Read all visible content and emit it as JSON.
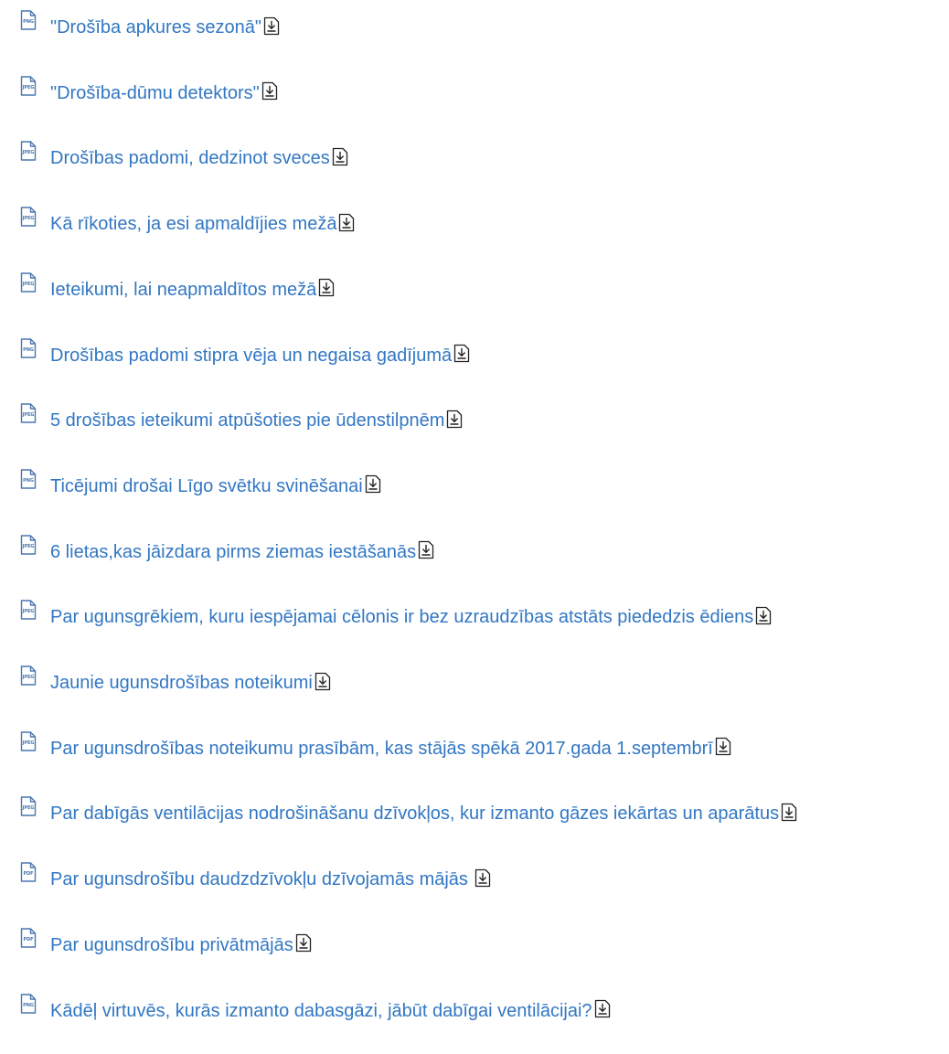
{
  "files": [
    {
      "ext": "PNG",
      "name": "\"Drošība apkures sezonā\""
    },
    {
      "ext": "JPEG",
      "name": "\"Drošība-dūmu detektors\""
    },
    {
      "ext": "JPEG",
      "name": "Drošības padomi, dedzinot sveces"
    },
    {
      "ext": "JPEG",
      "name": "Kā rīkoties, ja esi apmaldījies mežā"
    },
    {
      "ext": "JPEG",
      "name": "Ieteikumi, lai neapmaldītos mežā"
    },
    {
      "ext": "PNG",
      "name": "Drošības padomi stipra vēja un negaisa gadījumā"
    },
    {
      "ext": "JPEG",
      "name": "5 drošības ieteikumi atpūšoties pie ūdenstilpnēm"
    },
    {
      "ext": "PNG",
      "name": "Ticējumi drošai Līgo svētku svinēšanai"
    },
    {
      "ext": "JPEG",
      "name": "6 lietas,kas jāizdara pirms ziemas iestāšanās"
    },
    {
      "ext": "JPEG",
      "name": "Par ugunsgrēkiem, kuru iespējamai cēlonis ir bez uzraudzības atstāts piededzis ēdiens"
    },
    {
      "ext": "JPEG",
      "name": "Jaunie ugunsdrošības noteikumi"
    },
    {
      "ext": "JPEG",
      "name": "Par ugunsdrošības noteikumu prasībām, kas stājās spēkā 2017.gada 1.septembrī"
    },
    {
      "ext": "JPEG",
      "name": "Par dabīgās ventilācijas nodrošināšanu dzīvokļos, kur izmanto gāzes iekārtas un aparātus"
    },
    {
      "ext": "PDF",
      "name": "Par ugunsdrošību daudzdzīvokļu dzīvojamās mājās "
    },
    {
      "ext": "PDF",
      "name": "Par ugunsdrošību privātmājās"
    },
    {
      "ext": "PNG",
      "name": "Kādēļ virtuvēs, kurās izmanto dabasgāzi, jābūt dabīgai ventilācijai?"
    }
  ],
  "icons": {
    "file": "file-icon",
    "download": "download-icon"
  },
  "colors": {
    "link": "#3277c3",
    "icon": "#4a77b0"
  }
}
